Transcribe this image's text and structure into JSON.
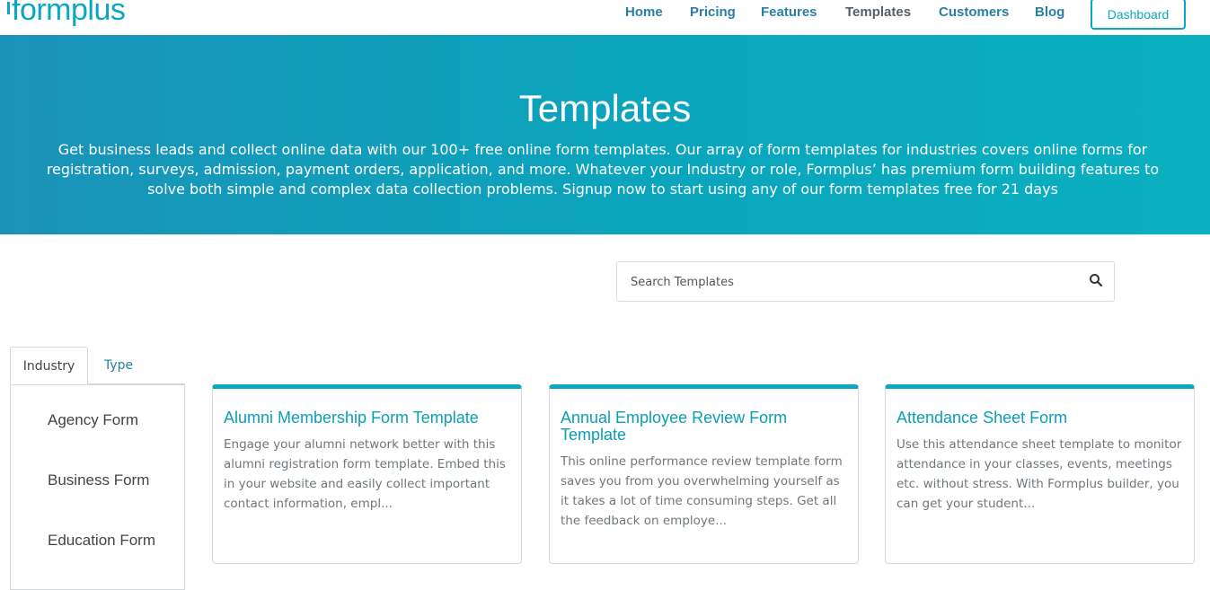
{
  "header": {
    "logo_text": "formplus",
    "nav": [
      {
        "label": "Home"
      },
      {
        "label": "Pricing"
      },
      {
        "label": "Features"
      },
      {
        "label": "Templates"
      },
      {
        "label": "Customers"
      },
      {
        "label": "Blog"
      }
    ],
    "dashboard_label": "Dashboard"
  },
  "hero": {
    "title": "Templates",
    "description": "Get business leads and collect online data with our 100+ free online form templates. Our array of form templates for industries covers online forms for registration, surveys, admission, payment orders, application, and more. Whatever your Industry or role, Formplus’ has premium form building features to solve both simple and complex data collection problems. Signup now to start using any of our form templates free for 21 days"
  },
  "search": {
    "placeholder": "Search Templates",
    "value": "",
    "icon": "search-icon"
  },
  "tabs": [
    {
      "label": "Industry",
      "active": true
    },
    {
      "label": "Type",
      "active": false
    }
  ],
  "sidebar": {
    "items": [
      {
        "label": "Agency Form"
      },
      {
        "label": "Business Form"
      },
      {
        "label": "Education Form"
      }
    ]
  },
  "cards": [
    {
      "title": "Alumni Membership Form Template",
      "description": "Engage your alumni network better with this alumni registration form template. Embed this in your website and easily collect important contact information, empl..."
    },
    {
      "title": "Annual Employee Review Form Template",
      "description": "This online performance review template form saves you from you overwhelming yourself as it takes a lot of time consuming steps. Get all the feedback on employe..."
    },
    {
      "title": "Attendance Sheet Form",
      "description": "Use this attendance sheet template to monitor attendance in your classes, events, meetings etc. without stress. With Formplus builder, you can get your student..."
    }
  ],
  "colors": {
    "brand": "#0aa8c0",
    "nav_link": "#2a7fa3",
    "hero_start": "#1a93b8",
    "hero_end": "#0ab0c0"
  }
}
